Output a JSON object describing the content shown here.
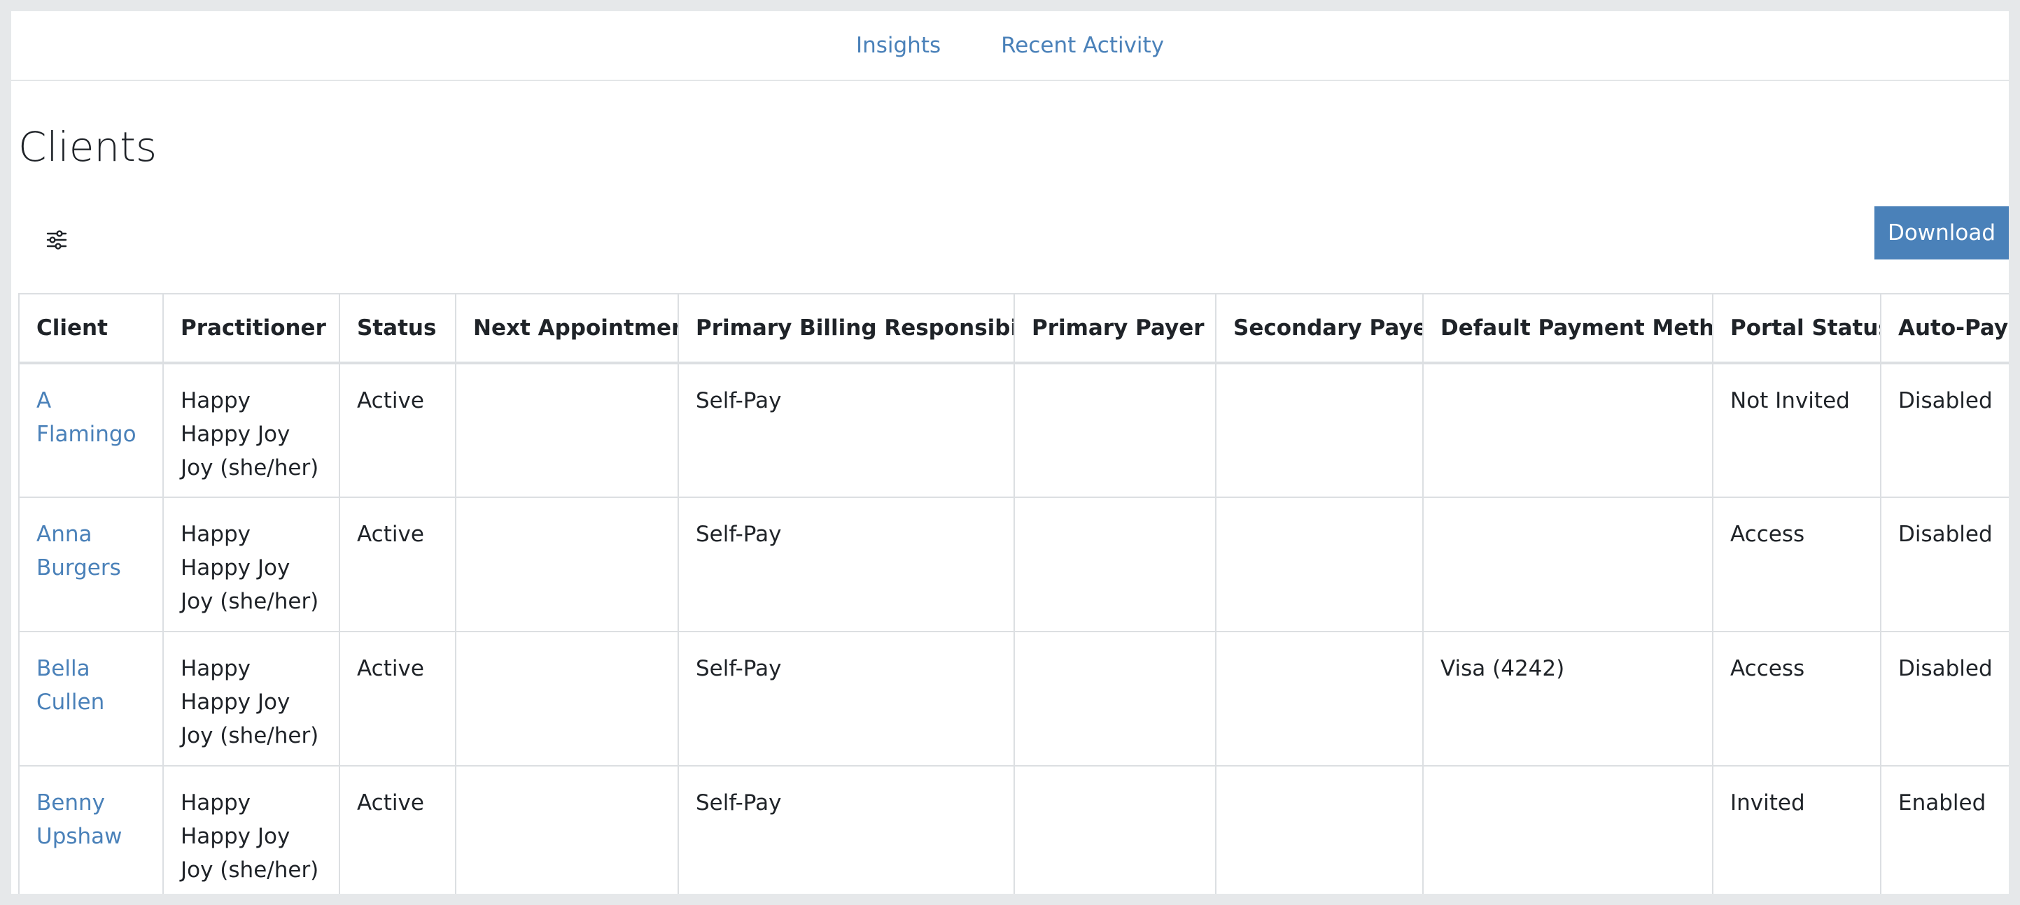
{
  "nav": {
    "items": [
      {
        "label": "Insights"
      },
      {
        "label": "Recent Activity"
      }
    ]
  },
  "page": {
    "title": "Clients"
  },
  "toolbar": {
    "filter_icon": "sliders-icon",
    "download_label": "Download"
  },
  "table": {
    "headers": [
      "Client",
      "Practitioner",
      "Status",
      "Next Appointment",
      "Primary Billing Responsibility",
      "Primary Payer",
      "Secondary Payer",
      "Default Payment Method",
      "Portal Status",
      "Auto-Pay"
    ],
    "rows": [
      {
        "client": "A Flamingo",
        "practitioner": "Happy Happy Joy Joy (she/her)",
        "status": "Active",
        "next_appointment": "",
        "primary_billing": "Self-Pay",
        "primary_payer": "",
        "secondary_payer": "",
        "default_payment": "",
        "portal_status": "Not Invited",
        "auto_pay": "Disabled"
      },
      {
        "client": "Anna Burgers",
        "practitioner": "Happy Happy Joy Joy (she/her)",
        "status": "Active",
        "next_appointment": "",
        "primary_billing": "Self-Pay",
        "primary_payer": "",
        "secondary_payer": "",
        "default_payment": "",
        "portal_status": "Access",
        "auto_pay": "Disabled"
      },
      {
        "client": "Bella Cullen",
        "practitioner": "Happy Happy Joy Joy (she/her)",
        "status": "Active",
        "next_appointment": "",
        "primary_billing": "Self-Pay",
        "primary_payer": "",
        "secondary_payer": "",
        "default_payment": "Visa (4242)",
        "portal_status": "Access",
        "auto_pay": "Disabled"
      },
      {
        "client": "Benny Upshaw",
        "practitioner": "Happy Happy Joy Joy (she/her)",
        "status": "Active",
        "next_appointment": "",
        "primary_billing": "Self-Pay",
        "primary_payer": "",
        "secondary_payer": "",
        "default_payment": "",
        "portal_status": "Invited",
        "auto_pay": "Enabled"
      }
    ]
  },
  "colors": {
    "accent": "#4a81b9",
    "border": "#dcdfe2",
    "text": "#1f2328"
  }
}
